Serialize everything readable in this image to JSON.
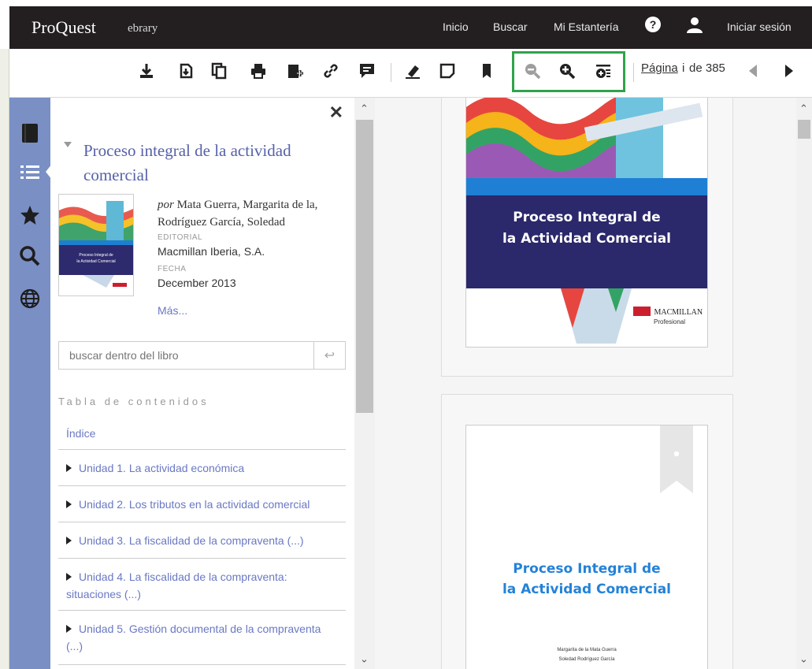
{
  "header": {
    "brand": "ProQuest",
    "product": "ebrary",
    "nav": [
      "Inicio",
      "Buscar",
      "Mi Estantería"
    ],
    "help_icon": "help-icon",
    "user_icon": "user-icon",
    "signin": "Iniciar sesión"
  },
  "toolbar": {
    "icons": [
      "download-icon",
      "copy-page-icon",
      "copy-icon",
      "print-icon",
      "add-to-shelf-icon",
      "link-icon",
      "comment-icon",
      "highlight-icon",
      "note-icon",
      "bookmark-icon",
      "zoom-out-icon",
      "zoom-in-icon",
      "fit-page-icon"
    ],
    "page_label": "Página",
    "page_current": "i",
    "page_total_text": "de 385",
    "zoom_highlight_color": "#2fa34a"
  },
  "rail": {
    "color": "#7a8fc4",
    "icons": [
      "book-icon",
      "toc-list-icon",
      "star-icon",
      "search-icon",
      "globe-icon"
    ]
  },
  "panel": {
    "title": "Proceso integral de la actividad comercial",
    "by_prefix": "por",
    "authors": "Mata Guerra, Margarita de la, Rodríguez García, Soledad",
    "publisher_label": "EDITORIAL",
    "publisher": "Macmillan Iberia, S.A.",
    "date_label": "FECHA",
    "date": "December 2013",
    "more": "Más...",
    "search_placeholder": "buscar dentro del libro",
    "toc_heading": "Tabla de contenidos",
    "toc_index": "Índice",
    "toc": [
      "Unidad 1. La actividad económica",
      "Unidad 2. Los tributos en la actividad comercial",
      "Unidad 3. La fiscalidad de la compraventa (...)",
      "Unidad 4. La fiscalidad de la compraventa: situaciones (...)",
      "Unidad 5. Gestión documental de la compraventa (...)"
    ]
  },
  "viewer": {
    "cover": {
      "title_line1": "Proceso Integral de",
      "title_line2": "la Actividad Comercial",
      "publisher_logo": "MACMILLAN",
      "publisher_sub": "Profesional"
    },
    "title_page": {
      "title_line1": "Proceso Integral de",
      "title_line2": "la Actividad Comercial",
      "author1": "Margarita de la Mata Guerra",
      "author2": "Soledad Rodríguez García"
    }
  }
}
